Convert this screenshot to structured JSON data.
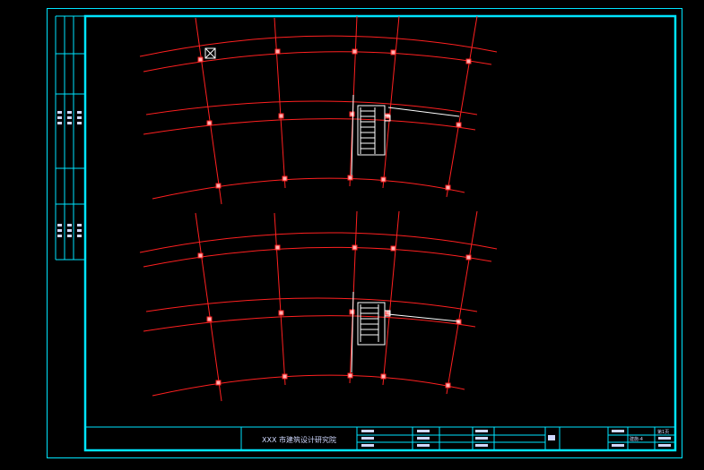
{
  "drawing": {
    "background": "#000000",
    "frame_color": "#00e5ff",
    "grid_color": "#ff2020",
    "column_color": "#ff8080",
    "wall_color": "#ffffff"
  },
  "title_block": {
    "institute": "XXX 市建筑设计研究院",
    "drawing_no": "建施-4",
    "sheet": "第1页"
  }
}
